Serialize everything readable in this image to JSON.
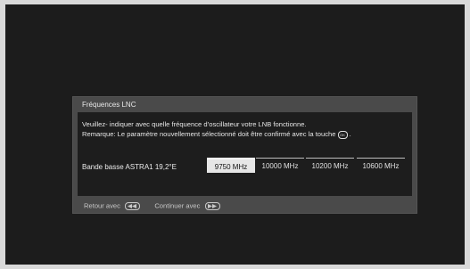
{
  "dialog": {
    "title": "Fréquences LNC",
    "message_line1": "Veuillez- indiquer avec quelle fréquence d’oscillateur votre LNB fonctionne.",
    "message_line2": "Remarque: Le paramètre nouvellement sélectionné doit être confirmé avec la touche",
    "ok_icon_text": "OK"
  },
  "band": {
    "label": "Bande basse ASTRA1 19,2°E",
    "options": [
      "9750 MHz",
      "10000 MHz",
      "10200 MHz",
      "10600 MHz"
    ],
    "selected_index": 0
  },
  "footer": {
    "back_label": "Retour avec",
    "back_icon": "rewind-icon",
    "continue_label": "Continuer avec",
    "continue_icon": "fast-forward-icon"
  },
  "colors": {
    "background": "#1c1c1c",
    "dialog": "#4a4a4a",
    "panel": "#1d1d1d",
    "selected": "#e6e6e6"
  }
}
